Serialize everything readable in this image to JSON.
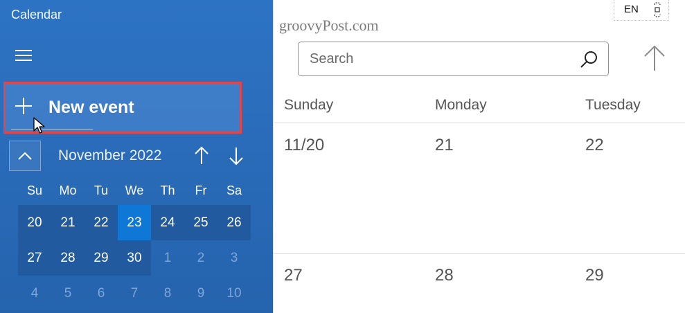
{
  "app": {
    "title": "Calendar"
  },
  "watermark": "groovyPost.com",
  "language": "EN",
  "new_event": {
    "label": "New event"
  },
  "mini_calendar": {
    "month": "November 2022",
    "days_of_week": [
      "Su",
      "Mo",
      "Tu",
      "We",
      "Th",
      "Fr",
      "Sa"
    ],
    "weeks": [
      [
        "20",
        "21",
        "22",
        "23",
        "24",
        "25",
        "26"
      ],
      [
        "27",
        "28",
        "29",
        "30",
        "1",
        "2",
        "3"
      ],
      [
        "4",
        "5",
        "6",
        "7",
        "8",
        "9",
        "10"
      ]
    ],
    "today": "23"
  },
  "search": {
    "placeholder": "Search",
    "value": ""
  },
  "week_view": {
    "headers": [
      "Sunday",
      "Monday",
      "Tuesday"
    ],
    "rows": [
      [
        "11/20",
        "21",
        "22"
      ],
      [
        "27",
        "28",
        "29"
      ]
    ]
  },
  "colors": {
    "sidebar": "#2a6cba",
    "today_highlight": "#0f78d7",
    "focus_outline": "#e0474c"
  }
}
